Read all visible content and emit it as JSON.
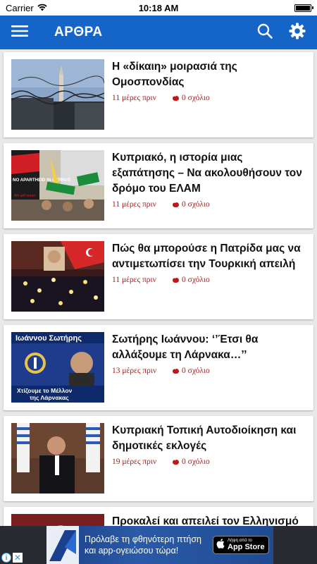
{
  "statusbar": {
    "carrier": "Carrier",
    "time": "10:18 AM"
  },
  "appbar": {
    "title": "ΑΡΘΡΑ"
  },
  "articles": [
    {
      "title": "Η «δίκαιη» μοιρασιά της Ομοσπονδίας",
      "date": "11 μέρες πριν",
      "comments": "0 σχόλιο"
    },
    {
      "title": "Κυπριακό, η ιστορία μιας εξαπάτησης – Να ακολουθήσουν τον δρόμο του ΕΛΑΜ",
      "date": "11 μέρες πριν",
      "comments": "0 σχόλιο"
    },
    {
      "title": "Πώς θα μπορούσε η Πατρίδα μας να αντιμετωπίσει την Τουρκική απειλή",
      "date": "11 μέρες πριν",
      "comments": "0 σχόλιο"
    },
    {
      "title": "Σωτήρης Ιωάννου: ‘’Έτσι θα αλλάξουμε τη Λάρνακα…’’",
      "date": "13 μέρες πριν",
      "comments": "0 σχόλιο"
    },
    {
      "title": "Κυπριακή Τοπική Αυτοδιοίκηση και δημοτικές εκλογές",
      "date": "19 μέρες πριν",
      "comments": "0 σχόλιο"
    },
    {
      "title": "Προκαλεί και απειλεί τον Ελληνισμό",
      "date": "",
      "comments": ""
    }
  ],
  "thumb_text": {
    "banner": "NO APARTHEID IN CYPRUS",
    "banner2": "We will return",
    "candidate_name": "Ιωάννου Σωτήρης",
    "slogan_line1": "Χτίζουμε το Μέλλον",
    "slogan_line2": "της Λάρνακας"
  },
  "ad": {
    "line1": "Πρόλαβε τη φθηνότερη πτήση",
    "line2": "και app-ογειώσου τώρα!",
    "store_small": "Λήψη από το",
    "store_big": "App Store",
    "info": "i",
    "close": "✕"
  },
  "colors": {
    "appbar": "#1565c8",
    "meta": "#a32020",
    "background": "#e8e8e8"
  }
}
